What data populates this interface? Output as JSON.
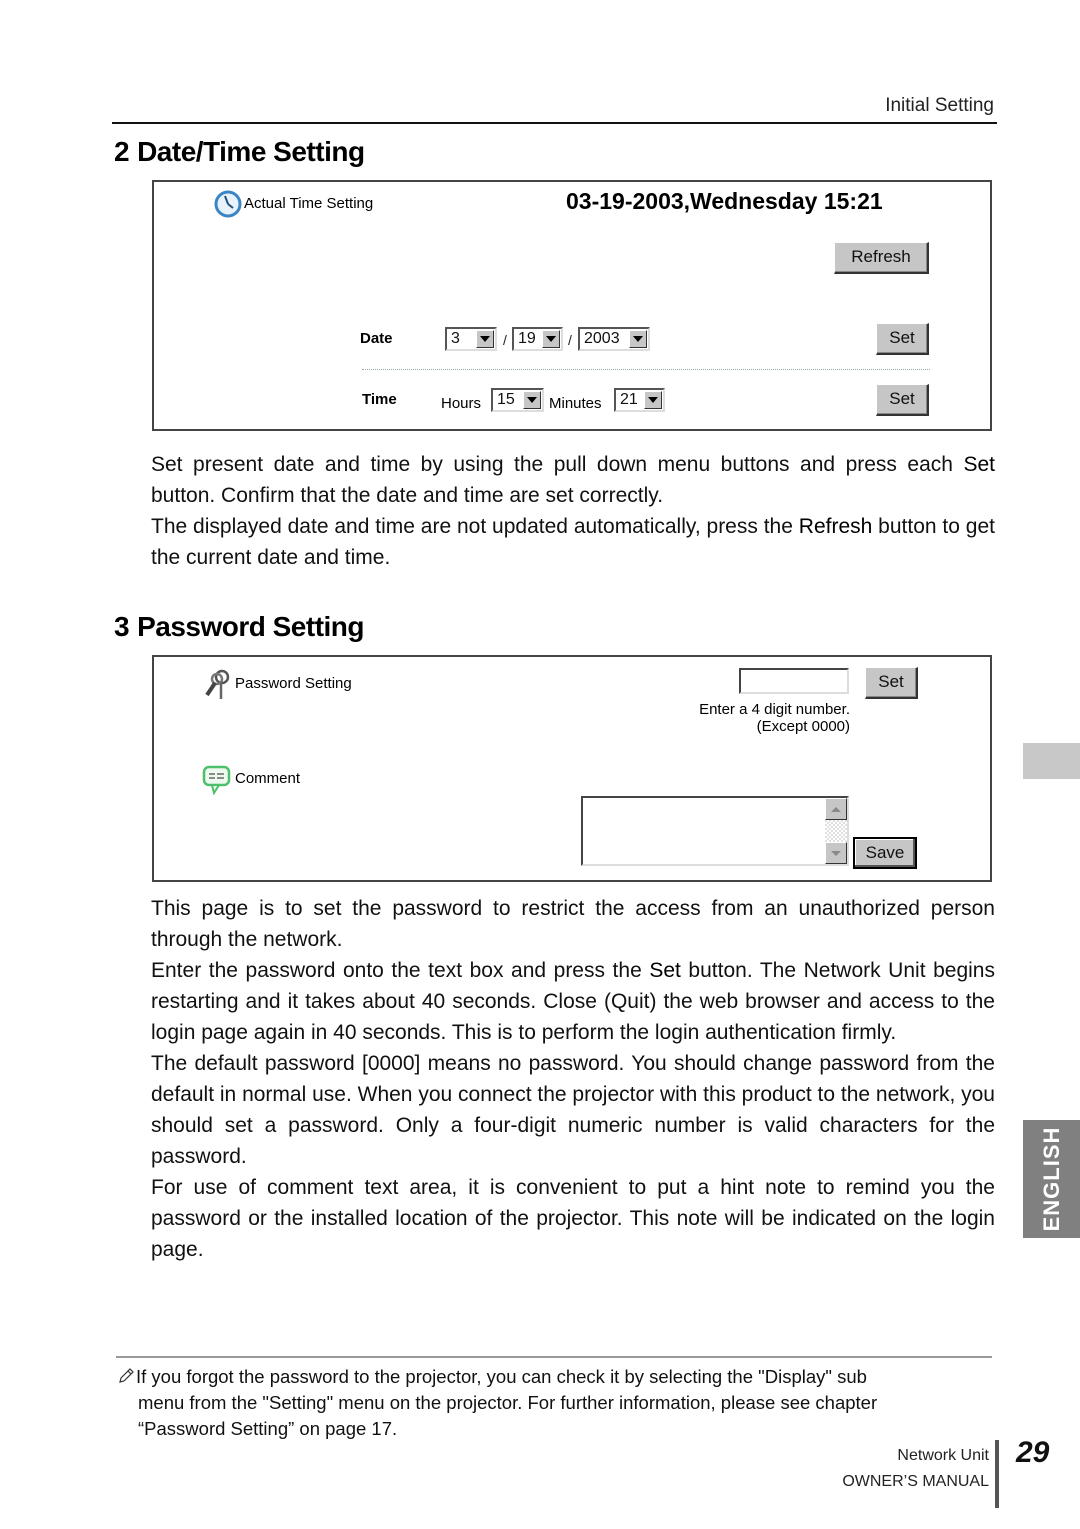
{
  "header": {
    "running_head": "Initial Setting"
  },
  "section2": {
    "number": "2",
    "title": "Date/Time Setting",
    "panel": {
      "heading": "Actual Time Setting",
      "heading_icon": "clock-icon",
      "current_datetime": "03-19-2003,Wednesday 15:21",
      "refresh_label": "Refresh",
      "date_label": "Date",
      "date_month": "3",
      "date_day": "19",
      "date_year": "2003",
      "date_separator": "/",
      "date_set_label": "Set",
      "time_label": "Time",
      "hours_label": "Hours",
      "hours_value": "15",
      "minutes_label": "Minutes",
      "minutes_value": "21",
      "time_set_label": "Set"
    },
    "paragraphs": [
      {
        "pre": "Set present date and time by using the pull down menu buttons and press each ",
        "bold": "Set",
        "post": " button. Confirm that the date and time are set correctly."
      },
      {
        "pre": "The displayed date and time are not updated automatically, press the ",
        "bold": "Refresh",
        "post": " button to get the current date and time."
      }
    ]
  },
  "section3": {
    "number": "3",
    "title": "Password Setting",
    "panel": {
      "password_heading": "Password Setting",
      "password_icon": "key-icon",
      "password_value": "",
      "set_label": "Set",
      "hint_line1": "Enter a 4 digit number.",
      "hint_line2": "(Except 0000)",
      "comment_heading": "Comment",
      "comment_icon": "speech-bubble-icon",
      "comment_value": "",
      "save_label": "Save"
    },
    "paragraphs": [
      {
        "pre": "This page is to set the password to restrict the access from an unauthorized person through the network.",
        "bold": "",
        "post": ""
      },
      {
        "pre": "Enter the password onto the text box and press the ",
        "bold": "Set",
        "post": " button. The Network Unit begins restarting and it takes about 40 seconds. Close (Quit) the web browser and access to the login page again in 40 seconds. This is to perform the login authentication firmly."
      },
      {
        "pre": "The default password [0000] means no password. You should change password from the default in normal use. When you connect the projector with this product to the network, you should set a password. Only a four-digit numeric number is valid characters for the password.",
        "bold": "",
        "post": ""
      },
      {
        "pre": "For use of comment text area, it is convenient to put a hint note to remind you the password or the installed location of the projector. This note will be indicated on the login page.",
        "bold": "",
        "post": ""
      }
    ]
  },
  "side_tab": {
    "label": "ENGLISH"
  },
  "note": {
    "icon": "pencil-icon",
    "line1": "If you forgot the password to the projector, you can check it by selecting the \"Display\" sub",
    "line2": "menu from the \"Setting\" menu on the projector. For further information, please see chapter",
    "line3": "“Password Setting” on page 17."
  },
  "footer": {
    "product": "Network Unit",
    "manual": "OWNER’S MANUAL",
    "page_number": "29"
  }
}
